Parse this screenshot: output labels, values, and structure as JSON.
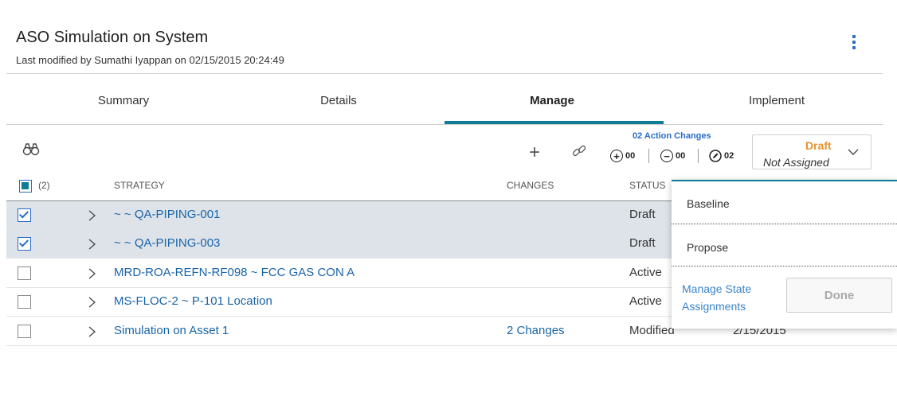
{
  "header": {
    "title": "ASO Simulation on System",
    "last_modified": "Last modified by Sumathi Iyappan on 02/15/2015 20:24:49"
  },
  "tabs": [
    {
      "label": "Summary"
    },
    {
      "label": "Details"
    },
    {
      "label": "Manage",
      "active": true
    },
    {
      "label": "Implement"
    }
  ],
  "toolbar": {
    "plus_glyph": "+",
    "action_changes_title": "02 Action Changes",
    "added_count": "00",
    "removed_count": "00",
    "modified_count": "02",
    "added_glyph": "+",
    "removed_glyph": "−"
  },
  "state": {
    "current": "Draft",
    "assignee": "Not Assigned"
  },
  "table": {
    "selected_count": "(2)",
    "columns": {
      "strategy": "STRATEGY",
      "changes": "CHANGES",
      "status": "STATUS"
    },
    "rows": [
      {
        "strategy": "~ ~ QA-PIPING-001",
        "changes": "",
        "status": "Draft",
        "date": "",
        "checked": true
      },
      {
        "strategy": "~ ~ QA-PIPING-003",
        "changes": "",
        "status": "Draft",
        "date": "",
        "checked": true
      },
      {
        "strategy": "MRD-ROA-REFN-RF098 ~ FCC GAS CON A",
        "changes": "",
        "status": "Active",
        "date": "",
        "checked": false
      },
      {
        "strategy": "MS-FLOC-2 ~ P-101 Location",
        "changes": "",
        "status": "Active",
        "date": "",
        "checked": false
      },
      {
        "strategy": "Simulation on Asset 1",
        "changes": "2 Changes",
        "status": "Modified",
        "date": "2/15/2015",
        "checked": false
      }
    ]
  },
  "dropdown": {
    "options": [
      "Baseline",
      "Propose"
    ],
    "manage_link": "Manage State Assignments",
    "done_label": "Done"
  },
  "colors": {
    "accent": "#0e7c96",
    "link": "#1a64a8",
    "draft": "#e8912e",
    "selected_row": "#dde3e9"
  }
}
